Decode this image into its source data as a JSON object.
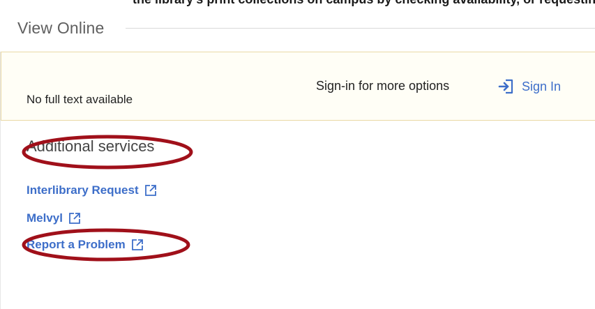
{
  "top_partial_text": "the library's print collections on campus by checking availability, or requesting the item if it's",
  "section": {
    "title": "View Online"
  },
  "signin": {
    "prompt": "Sign-in for more options",
    "link_label": "Sign In",
    "icon": "sign-in-icon"
  },
  "availability": {
    "message": "No full text available"
  },
  "additional": {
    "heading": "Additional services",
    "links": [
      {
        "label": "Interlibrary Request",
        "icon": "external-link-icon"
      },
      {
        "label": "Melvyl",
        "icon": "external-link-icon"
      },
      {
        "label": "Report a Problem",
        "icon": "external-link-icon"
      }
    ]
  },
  "colors": {
    "link": "#3d6ec9",
    "annotation": "#a0101a",
    "signin_bar_bg": "#fffef6",
    "signin_bar_border": "#ead9a5"
  }
}
